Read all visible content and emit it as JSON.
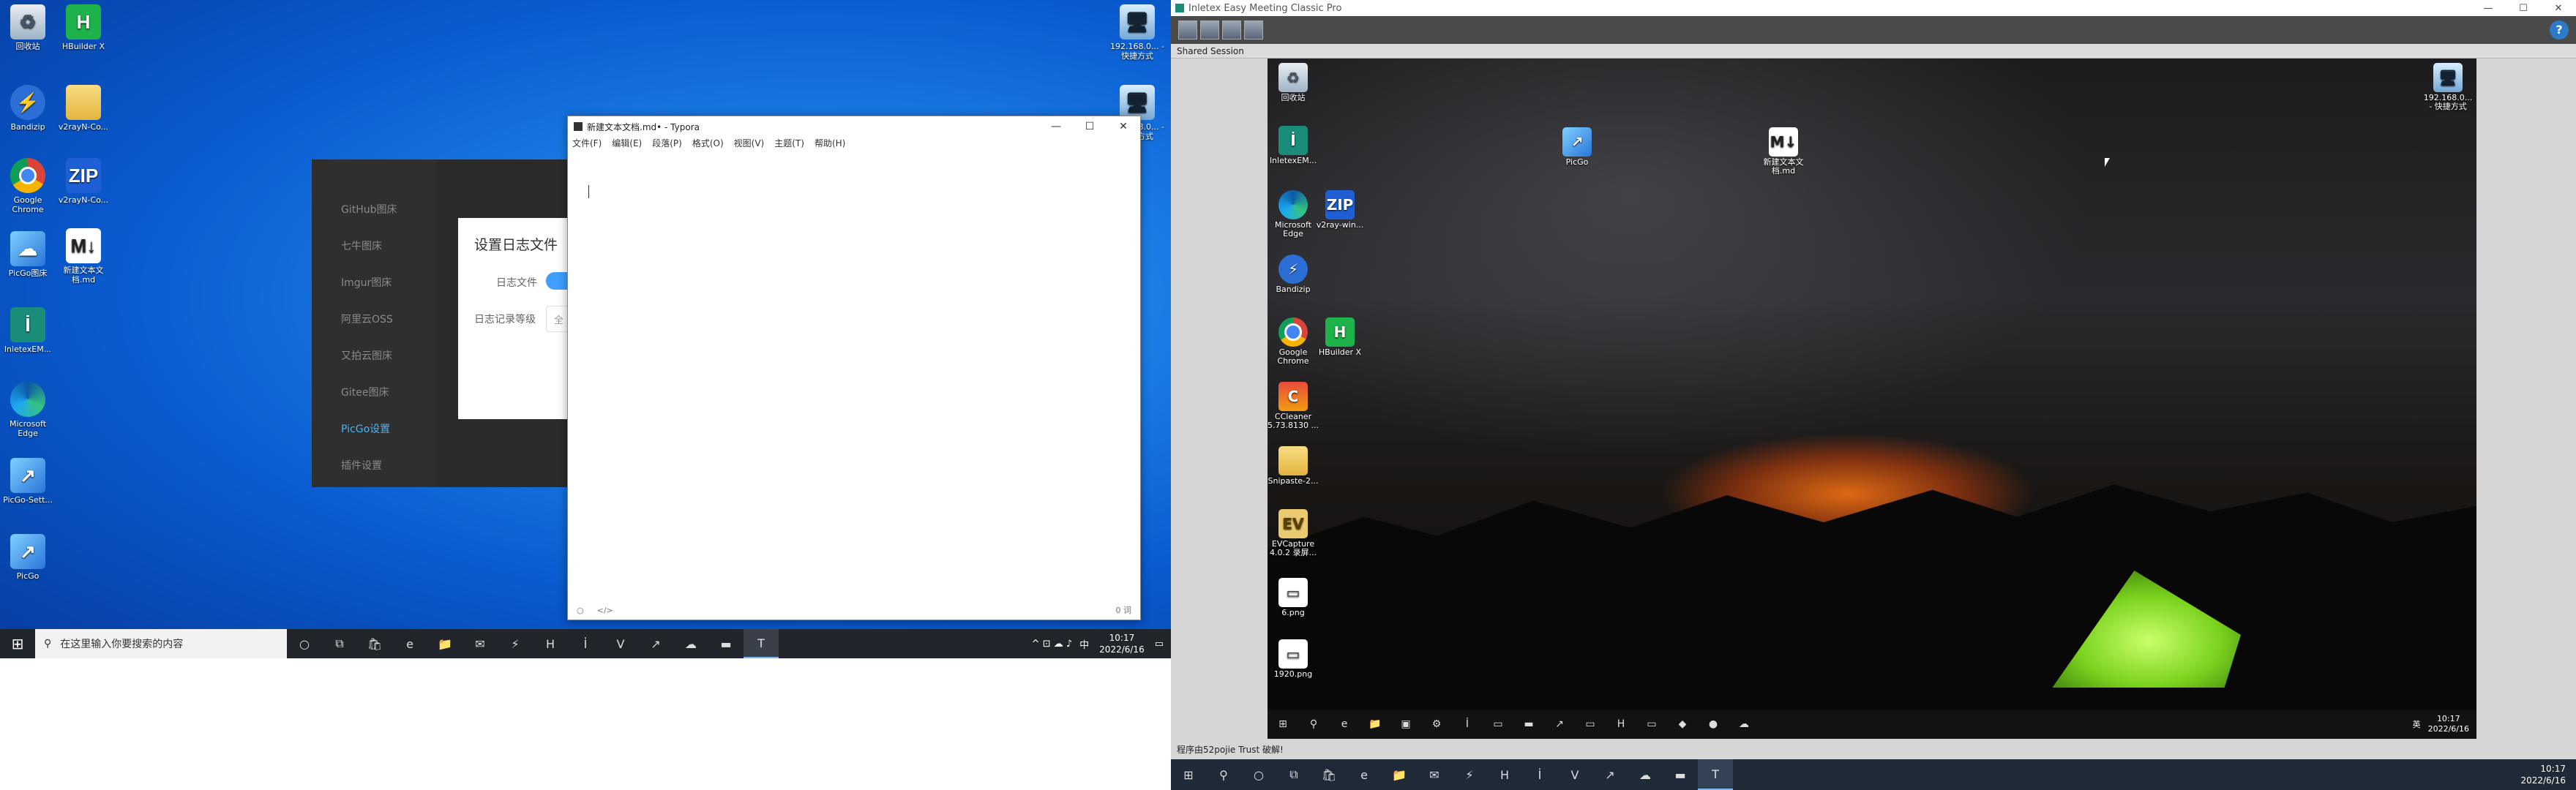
{
  "left_desktop": {
    "icons": [
      {
        "label": "回收站",
        "icon": "recycle-bin-icon",
        "glyph": "♻"
      },
      {
        "label": "HBuilder X",
        "icon": "hbuilder-icon",
        "glyph": "H"
      },
      {
        "label": "Bandizip",
        "icon": "bandizip-icon",
        "glyph": "⚡"
      },
      {
        "label": "v2rayN-Co...",
        "icon": "folder-icon",
        "glyph": ""
      },
      {
        "label": "Google Chrome",
        "icon": "chrome-icon",
        "glyph": ""
      },
      {
        "label": "v2rayN-Co...",
        "icon": "v2ray-zip-icon",
        "glyph": "ZIP"
      },
      {
        "label": "PicGo图床",
        "icon": "picgo-icon",
        "glyph": "☁"
      },
      {
        "label": "新建文本文档.md",
        "icon": "markdown-file-icon",
        "glyph": "M↓"
      },
      {
        "label": "InletexEM...",
        "icon": "inletex-icon",
        "glyph": "İ"
      },
      {
        "label": "Microsoft Edge",
        "icon": "edge-icon",
        "glyph": ""
      },
      {
        "label": "PicGo-Sett...",
        "icon": "picgo-settings-icon",
        "glyph": "↗"
      },
      {
        "label": "PicGo",
        "icon": "picgo-app-icon",
        "glyph": "↗"
      },
      {
        "label": "192.168.0... - 快捷方式",
        "icon": "network-shortcut-icon",
        "glyph": "🖥"
      },
      {
        "label": "192.168.0... - 快捷方式",
        "icon": "network-shortcut-icon-2",
        "glyph": "🖥"
      }
    ]
  },
  "picgo": {
    "sidebar": [
      "GitHub图床",
      "七牛图床",
      "Imgur图床",
      "阿里云OSS",
      "又拍云图床",
      "Gitee图床",
      "PicGo设置",
      "插件设置"
    ],
    "active_index": 6,
    "dialog": {
      "title": "设置日志文件",
      "log_file_label": "日志文件",
      "log_level_label": "日志记录等级",
      "log_level_value": "全"
    }
  },
  "typora": {
    "title": "新建文本文档.md• - Typora",
    "menu": [
      "文件(F)",
      "编辑(E)",
      "段落(P)",
      "格式(O)",
      "视图(V)",
      "主题(T)",
      "帮助(H)"
    ],
    "status_left": "○",
    "status_code": "</>",
    "word_count": "0 词",
    "window_buttons": [
      "—",
      "☐",
      "✕"
    ]
  },
  "left_taskbar": {
    "search_placeholder": "在这里输入你要搜索的内容",
    "apps": [
      "○",
      "⧉",
      "🛍",
      "e",
      "📁",
      "✉",
      "⚡",
      "H",
      "İ",
      "V",
      "↗",
      "☁",
      "▬",
      "T"
    ],
    "time": "10:17",
    "date": "2022/6/16",
    "ime": "中",
    "tray_icons": "^ ⊡ ☁ ♪"
  },
  "viewer": {
    "title": "Inletex Easy Meeting Classic Pro",
    "tab": "Shared Session",
    "window_buttons": [
      "—",
      "☐",
      "✕"
    ],
    "help": "?",
    "status_text": "程序由52pojie Trust 破解!",
    "remote_icons": [
      {
        "label": "回收站",
        "glyph": "♻"
      },
      {
        "label": "InletexEM...",
        "glyph": "İ"
      },
      {
        "label": "Microsoft Edge",
        "glyph": ""
      },
      {
        "label": "v2ray-win...",
        "glyph": "ZIP"
      },
      {
        "label": "Bandizip",
        "glyph": "⚡"
      },
      {
        "label": "Google Chrome",
        "glyph": ""
      },
      {
        "label": "HBuilder X",
        "glyph": "H"
      },
      {
        "label": "CCleaner 5.73.8130 ...",
        "glyph": "C"
      },
      {
        "label": "Snipaste-2...",
        "glyph": ""
      },
      {
        "label": "EVCapture 4.0.2 录屏...",
        "glyph": "EV"
      },
      {
        "label": "6.png",
        "glyph": "▭"
      },
      {
        "label": "1920.png",
        "glyph": "▭"
      },
      {
        "label": "PicGo",
        "glyph": "↗"
      },
      {
        "label": "新建文本文档.md",
        "glyph": "M↓"
      },
      {
        "label": "192.168.0... - 快捷方式",
        "glyph": "🖥"
      }
    ],
    "remote_taskbar_apps": [
      "⊞",
      "⚲",
      "e",
      "📁",
      "▣",
      "⚙",
      "İ",
      "▭",
      "▬",
      "↗",
      "▭",
      "H",
      "▭",
      "◆",
      "●",
      "☁"
    ],
    "remote_time": "10:17",
    "remote_date": "2022/6/16",
    "remote_ime": "英"
  },
  "right_taskbar": {
    "apps": [
      "⊞",
      "⚲",
      "○",
      "⧉",
      "🛍",
      "e",
      "📁",
      "✉",
      "⚡",
      "H",
      "İ",
      "V",
      "↗",
      "☁",
      "▬",
      "T"
    ],
    "time": "10:17",
    "date": "2022/6/16"
  }
}
